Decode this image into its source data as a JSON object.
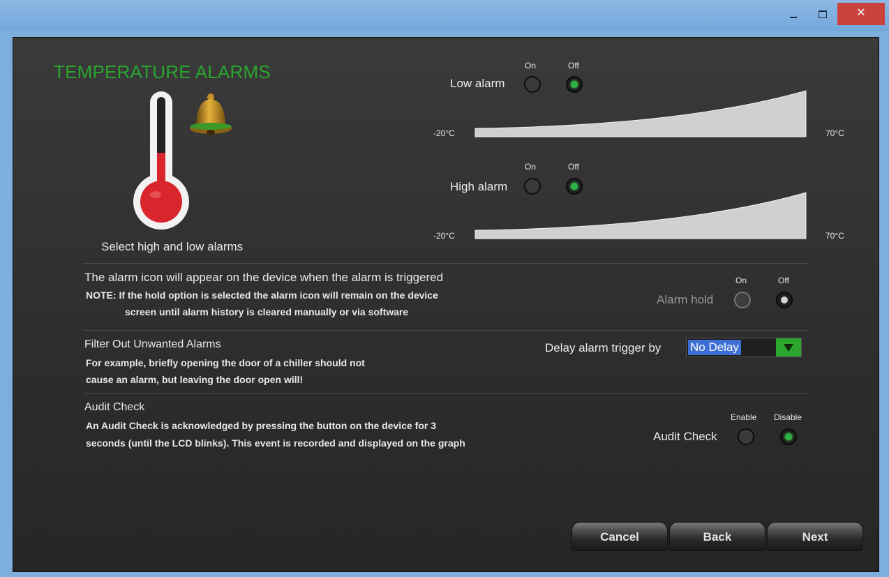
{
  "window": {
    "minimize_label": "",
    "maximize_label": "",
    "close_label": "✕"
  },
  "page": {
    "title": "TEMPERATURE ALARMS",
    "select_caption": "Select high and low alarms"
  },
  "low_alarm": {
    "label": "Low alarm",
    "on_label": "On",
    "off_label": "Off",
    "selected": "off",
    "min_label": "-20°C",
    "max_label": "70°C"
  },
  "high_alarm": {
    "label": "High alarm",
    "on_label": "On",
    "off_label": "Off",
    "selected": "off",
    "min_label": "-20°C",
    "max_label": "70°C"
  },
  "alarm_hold": {
    "heading": "The alarm icon will appear on the device when the alarm is triggered",
    "note_line1": "NOTE: If the hold option is selected the alarm icon will remain on the device",
    "note_line2": "screen until alarm history is cleared manually or via software",
    "label": "Alarm hold",
    "on_label": "On",
    "off_label": "Off",
    "selected": "off"
  },
  "filter": {
    "heading": "Filter Out Unwanted Alarms",
    "desc_line1": "For example, briefly opening the door of a chiller should not",
    "desc_line2": "cause an alarm, but leaving the door open will!",
    "delay_label": "Delay alarm trigger by",
    "delay_value": "No Delay"
  },
  "audit": {
    "heading": "Audit Check",
    "desc_line1": "An Audit Check is acknowledged by pressing the button on the device for 3",
    "desc_line2": "seconds (until the LCD blinks). This event is recorded and displayed on the graph",
    "label": "Audit Check",
    "enable_label": "Enable",
    "disable_label": "Disable",
    "selected": "disable"
  },
  "buttons": {
    "cancel": "Cancel",
    "back": "Back",
    "next": "Next"
  },
  "colors": {
    "accent_green": "#2aa52e",
    "thermo_red": "#d9262c",
    "selection_blue": "#3d6fd4",
    "close_red": "#c9433c"
  }
}
